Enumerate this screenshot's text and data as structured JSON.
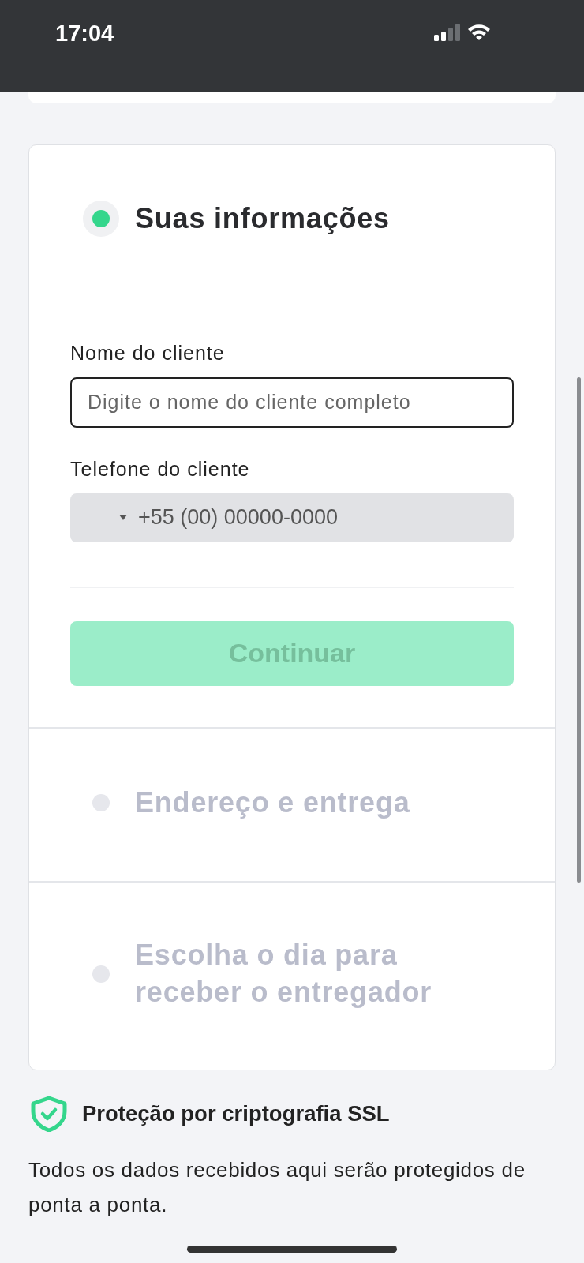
{
  "status_bar": {
    "time": "17:04"
  },
  "steps": [
    {
      "title": "Suas informações",
      "active": true
    },
    {
      "title": "Endereço e entrega",
      "active": false
    },
    {
      "title": "Escolha o dia para receber o entregador",
      "active": false
    }
  ],
  "form": {
    "name_label": "Nome do cliente",
    "name_placeholder": "Digite o nome do cliente completo",
    "phone_label": "Telefone do cliente",
    "phone_placeholder": "+55 (00) 00000-0000",
    "continue_button": {
      "label": "Continuar",
      "disabled": true
    }
  },
  "security": {
    "title": "Proteção por criptografia SSL",
    "text": "Todos os dados recebidos aqui serão protegidos de ponta a ponta."
  }
}
